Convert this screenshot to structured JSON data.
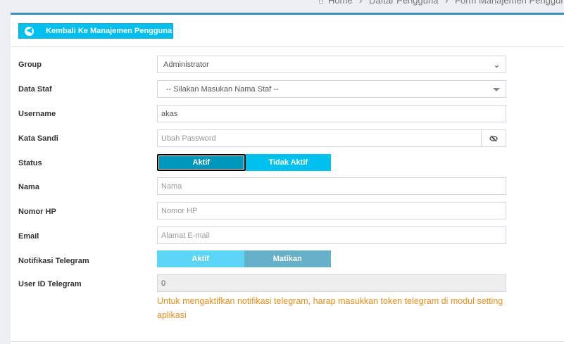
{
  "breadcrumb": {
    "home": "Home",
    "sep": "›",
    "list": "Daftar Pengguna",
    "form": "Form Manajemen Pengguna"
  },
  "back_button": {
    "label": "Kembali Ke Manajemen Pengguna",
    "icon": "arrow-circle-left-icon"
  },
  "form": {
    "group": {
      "label": "Group",
      "value": "Administrator"
    },
    "staff": {
      "label": "Data Staf",
      "value": "-- Silakan Masukan Nama Staf --"
    },
    "username": {
      "label": "Username",
      "value": "akas"
    },
    "password": {
      "label": "Kata Sandi",
      "placeholder": "Ubah Password",
      "icon": "eye-slash-icon"
    },
    "status": {
      "label": "Status",
      "options": [
        "Aktif",
        "Tidak Aktif"
      ],
      "selected": "Aktif"
    },
    "name": {
      "label": "Nama",
      "placeholder": "Nama"
    },
    "phone": {
      "label": "Nomor HP",
      "placeholder": "Nomor HP"
    },
    "email": {
      "label": "Email",
      "placeholder": "Alamat E-mail"
    },
    "telegram_notif": {
      "label": "Notifikasi Telegram",
      "options": [
        "Aktif",
        "Matikan"
      ],
      "selected": "Matikan"
    },
    "telegram_id": {
      "label": "User ID Telegram",
      "value": "0"
    },
    "hint": "Untuk mengaktifkan notifikasi telegram, harap masukkan token telegram di modul setting aplikasi"
  },
  "colors": {
    "accent": "#00c0ef",
    "hint": "#e88f1a",
    "border_top": "#3c8dbc"
  }
}
